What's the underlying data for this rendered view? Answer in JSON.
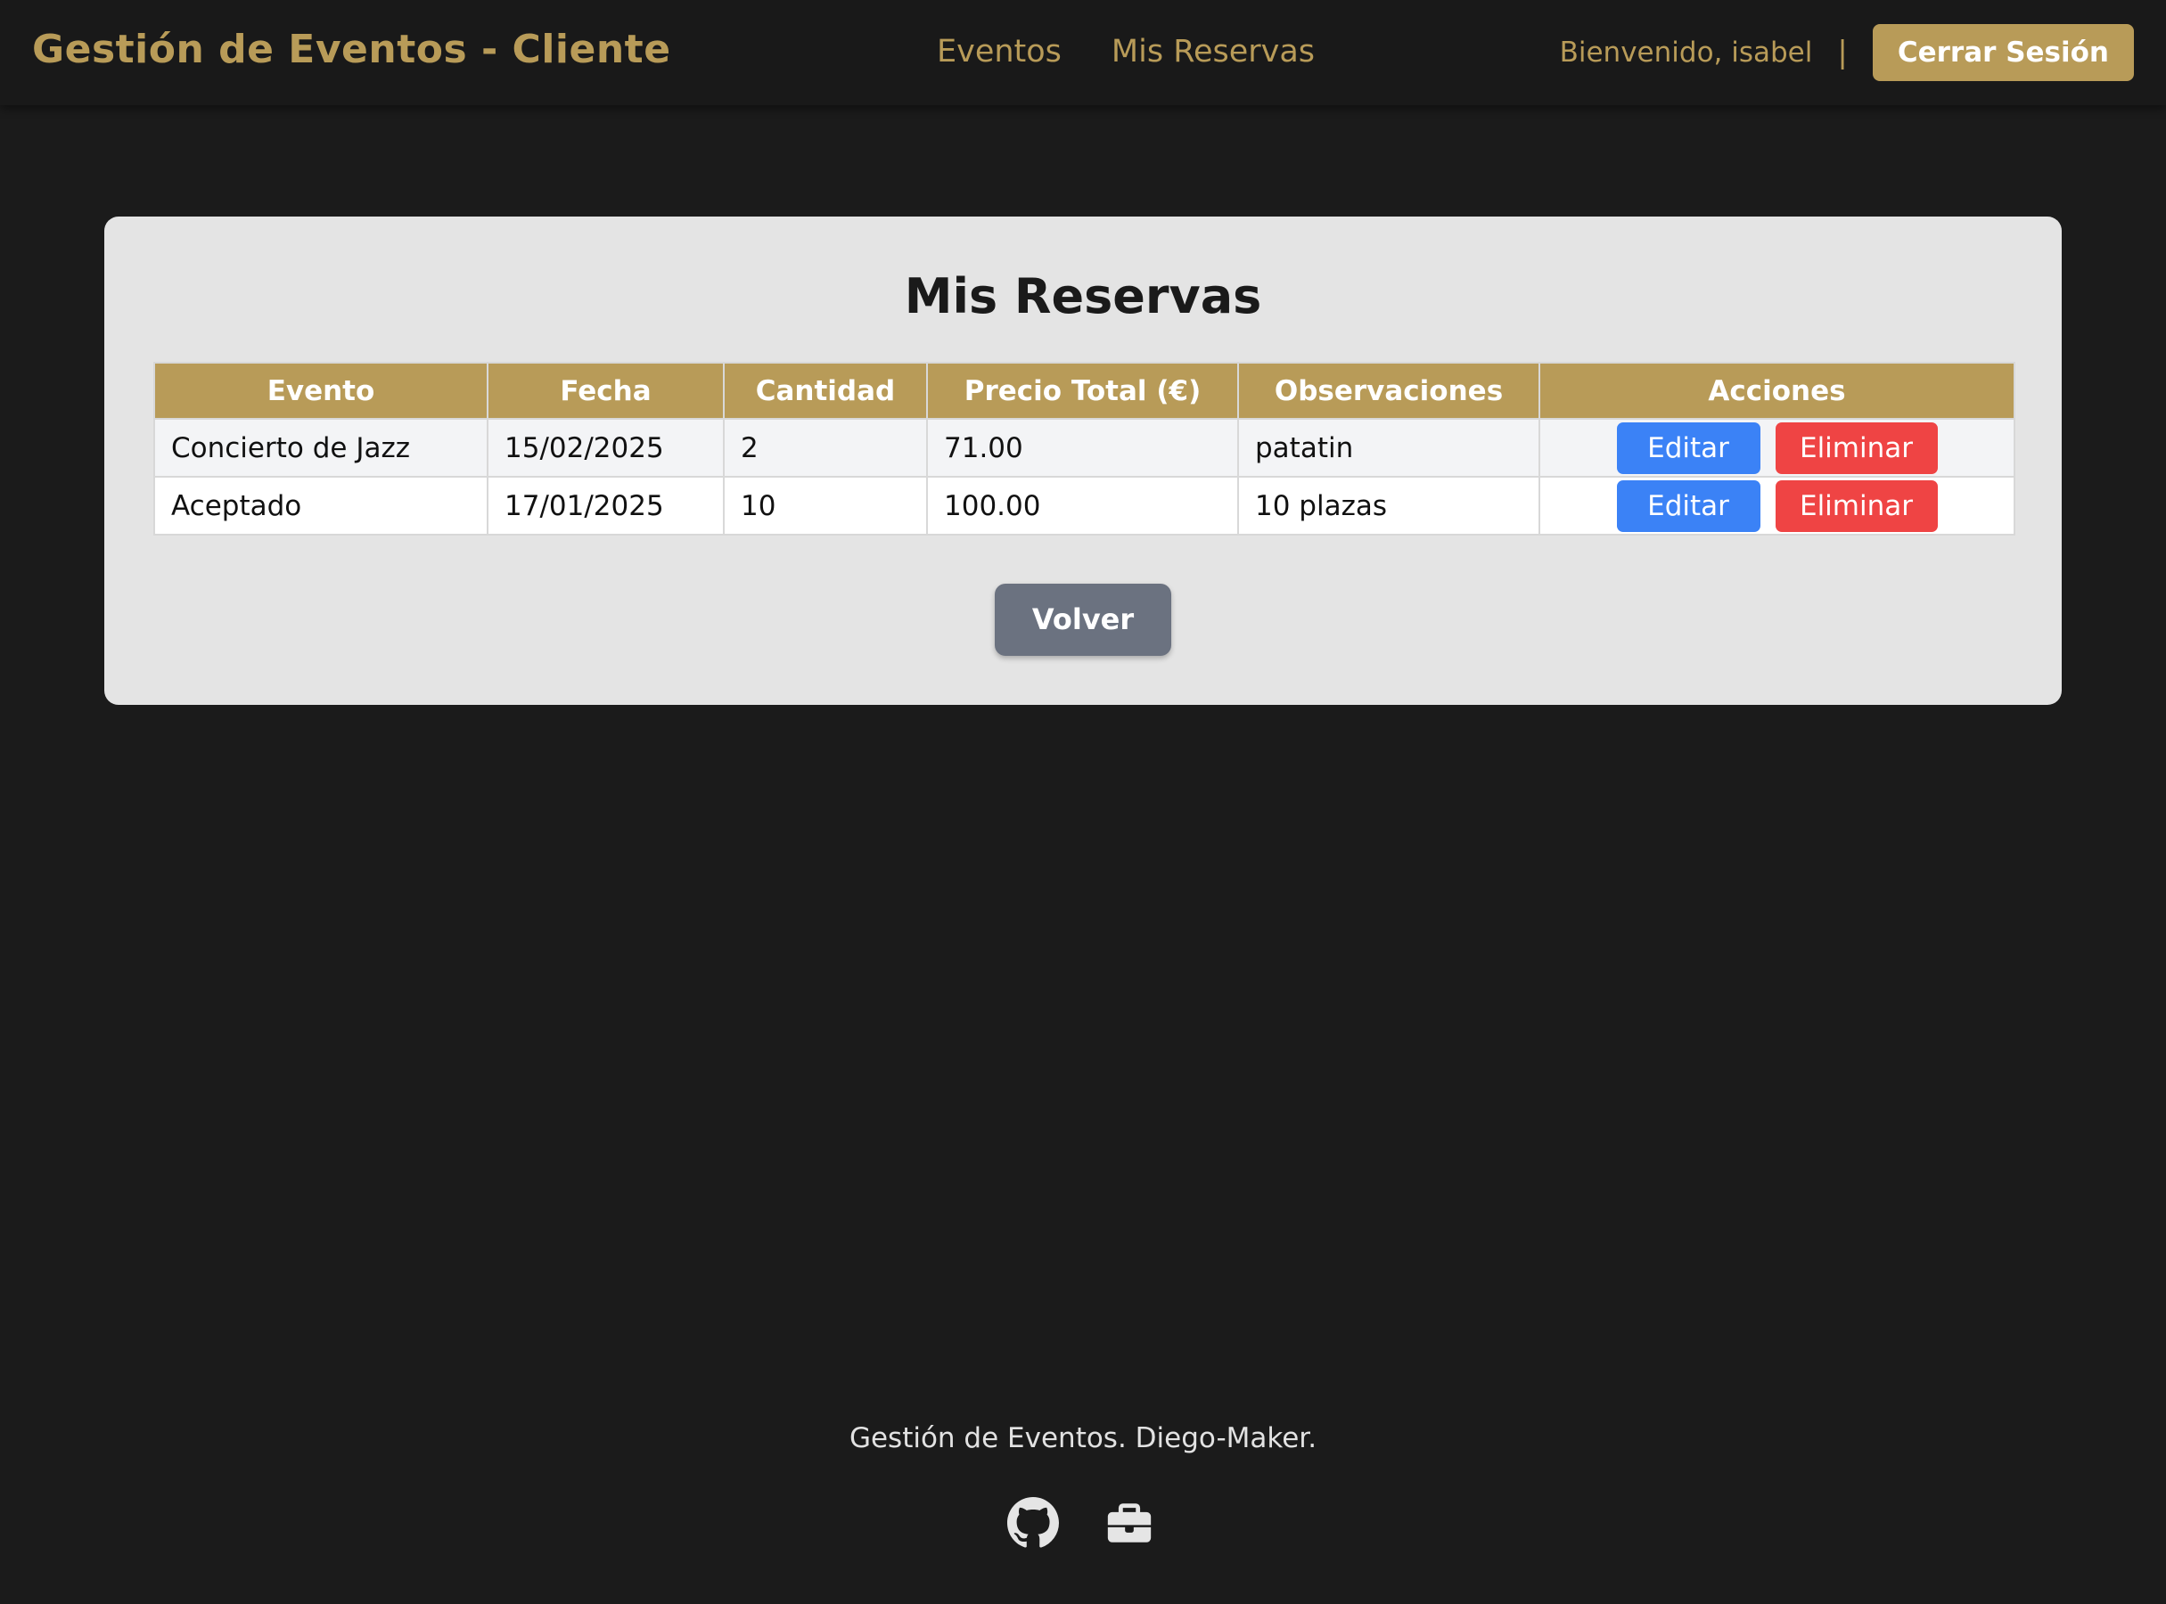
{
  "header": {
    "brand": "Gestión de Eventos - Cliente",
    "nav": {
      "eventos": "Eventos",
      "mis_reservas": "Mis Reservas"
    },
    "welcome": "Bienvenido, isabel",
    "divider": "|",
    "logout_label": "Cerrar Sesión"
  },
  "main": {
    "title": "Mis Reservas",
    "table": {
      "columns": [
        "Evento",
        "Fecha",
        "Cantidad",
        "Precio Total (€)",
        "Observaciones",
        "Acciones"
      ],
      "rows": [
        {
          "evento": "Concierto de Jazz",
          "fecha": "15/02/2025",
          "cantidad": "2",
          "precio_total": "71.00",
          "observaciones": "patatin",
          "edit_label": "Editar",
          "delete_label": "Eliminar"
        },
        {
          "evento": "Aceptado",
          "fecha": "17/01/2025",
          "cantidad": "10",
          "precio_total": "100.00",
          "observaciones": "10 plazas",
          "edit_label": "Editar",
          "delete_label": "Eliminar"
        }
      ]
    },
    "back_label": "Volver"
  },
  "footer": {
    "text": "Gestión de Eventos. Diego-Maker.",
    "icons": [
      "github-icon",
      "briefcase-icon"
    ]
  },
  "colors": {
    "background": "#1b1b1b",
    "accent_gold": "#b89b58",
    "card": "#e4e4e4",
    "edit_blue": "#3b82f6",
    "delete_red": "#ef4444",
    "back_gray": "#6b7280"
  }
}
